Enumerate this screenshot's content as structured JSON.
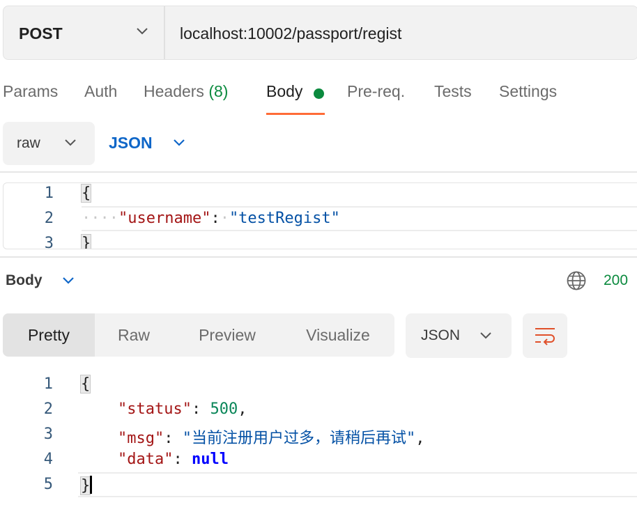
{
  "request": {
    "method": "POST",
    "url": "localhost:10002/passport/regist"
  },
  "tabs": [
    {
      "label": "Params"
    },
    {
      "label": "Auth"
    },
    {
      "label": "Headers",
      "count": "(8)"
    },
    {
      "label": "Body"
    },
    {
      "label": "Pre-req."
    },
    {
      "label": "Tests"
    },
    {
      "label": "Settings"
    }
  ],
  "body_options": {
    "mode": "raw",
    "language": "JSON"
  },
  "request_editor": {
    "line_numbers": [
      "1",
      "2",
      "3"
    ],
    "open_brace": "{",
    "dots": "····",
    "key": "\"username\"",
    "colon": ":",
    "dot_after_colon": "·",
    "value": "\"testRegist\"",
    "close_brace": "}"
  },
  "response": {
    "title": "Body",
    "status": "200",
    "view_tabs": [
      "Pretty",
      "Raw",
      "Preview",
      "Visualize"
    ],
    "format": "JSON",
    "line_numbers": [
      "1",
      "2",
      "3",
      "4",
      "5"
    ],
    "open_brace": "{",
    "close_brace": "}",
    "fields": [
      {
        "key": "\"status\"",
        "value": "500",
        "comma": ","
      },
      {
        "key": "\"msg\"",
        "value": "\"当前注册用户过多，请稍后再试\"",
        "comma": ","
      },
      {
        "key": "\"data\"",
        "value": "null",
        "comma": ""
      }
    ]
  },
  "colors": {
    "accent": "#ff6c37",
    "status_green": "#0b8a3e",
    "link_blue": "#0e66c8"
  }
}
